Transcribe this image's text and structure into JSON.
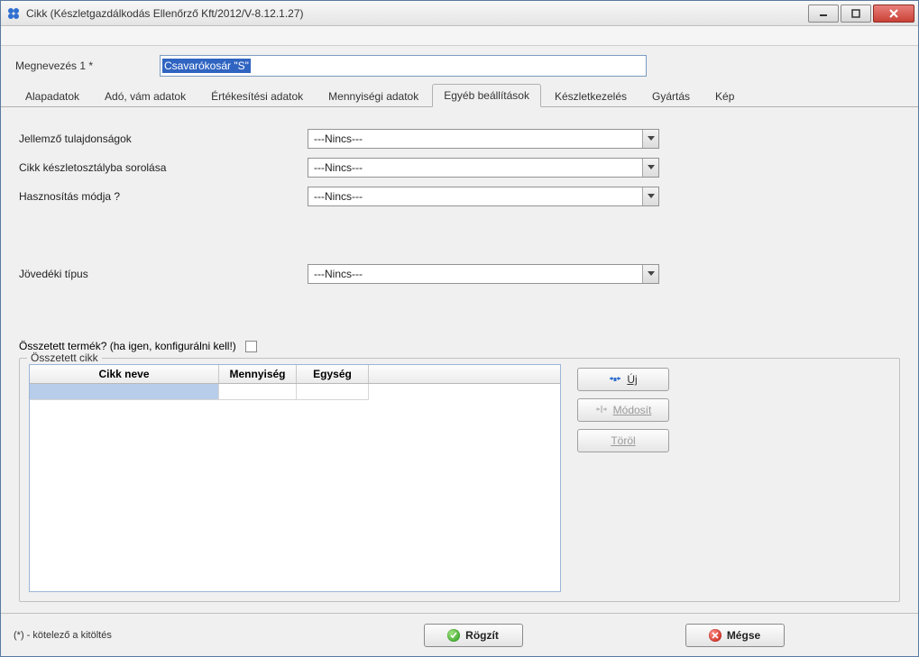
{
  "window": {
    "title": "Cikk (Készletgazdálkodás Ellenőrző Kft/2012/V-8.12.1.27)"
  },
  "header": {
    "name_label": "Megnevezés 1 *",
    "name_value": "Csavarókosár \"S\""
  },
  "tabs": [
    {
      "label": "Alapadatok"
    },
    {
      "label": "Adó, vám adatok"
    },
    {
      "label": "Értékesítési adatok"
    },
    {
      "label": "Mennyiségi adatok"
    },
    {
      "label": "Egyéb beállítások",
      "active": true
    },
    {
      "label": "Készletkezelés"
    },
    {
      "label": "Gyártás"
    },
    {
      "label": "Kép"
    }
  ],
  "form": {
    "jellemzo_label": "Jellemző tulajdonságok",
    "jellemzo_value": "---Nincs---",
    "keszletosztaly_label": "Cikk készletosztályba sorolása",
    "keszletosztaly_value": "---Nincs---",
    "hasznositas_label": "Hasznosítás módja ?",
    "hasznositas_value": "---Nincs---",
    "jovedeki_label": "Jövedéki típus",
    "jovedeki_value": "---Nincs---",
    "osszetett_label": "Összetett termék?  (ha igen, konfigurálni kell!)"
  },
  "group": {
    "title": "Összetett cikk",
    "columns": {
      "col1": "Cikk neve",
      "col2": "Mennyiség",
      "col3": "Egység"
    }
  },
  "buttons": {
    "new": "Új",
    "modify": "Módosít",
    "delete": "Töröl",
    "save": "Rögzít",
    "cancel": "Mégse"
  },
  "footer": {
    "note": "(*) - kötelező a kitöltés"
  }
}
